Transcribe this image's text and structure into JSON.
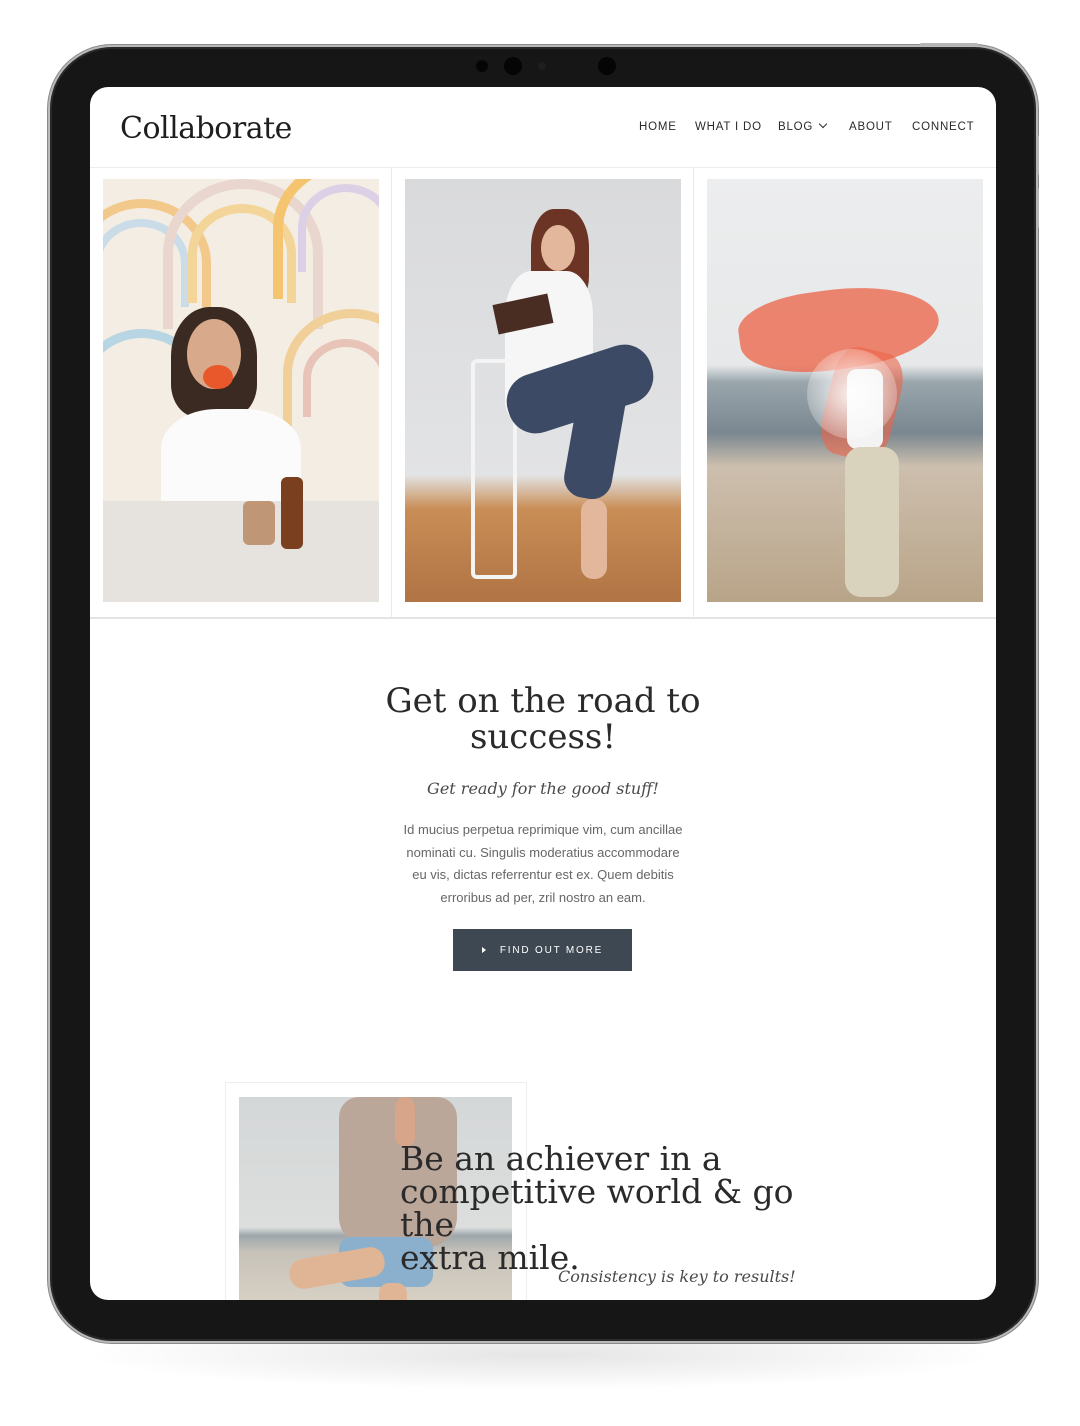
{
  "site": {
    "logo": "Collaborate"
  },
  "nav": {
    "items": [
      {
        "label": "HOME"
      },
      {
        "label": "WHAT I DO"
      },
      {
        "label": "BLOG"
      },
      {
        "label": "ABOUT"
      },
      {
        "label": "CONNECT"
      }
    ]
  },
  "hero": {
    "title_line1": "Get on the road to",
    "title_line2": "success!",
    "subtitle": "Get ready for the good stuff!",
    "paragraph_lines": [
      "Id mucius perpetua reprimique vim, cum ancillae",
      "nominati cu. Singulis moderatius accommodare",
      "eu vis, dictas referrentur est ex. Quem debitis",
      "erroribus ad per, zril nostro an eam."
    ],
    "cta_label": "FIND OUT MORE"
  },
  "feature": {
    "title_line1": "Be an achiever in a",
    "title_line2": "competitive world & go the",
    "title_line3": "extra mile.",
    "subtitle": "Consistency is key to results!"
  },
  "colors": {
    "button_bg": "#3e4852",
    "text_dark": "#2a2a2a",
    "device_frame": "#161616"
  }
}
